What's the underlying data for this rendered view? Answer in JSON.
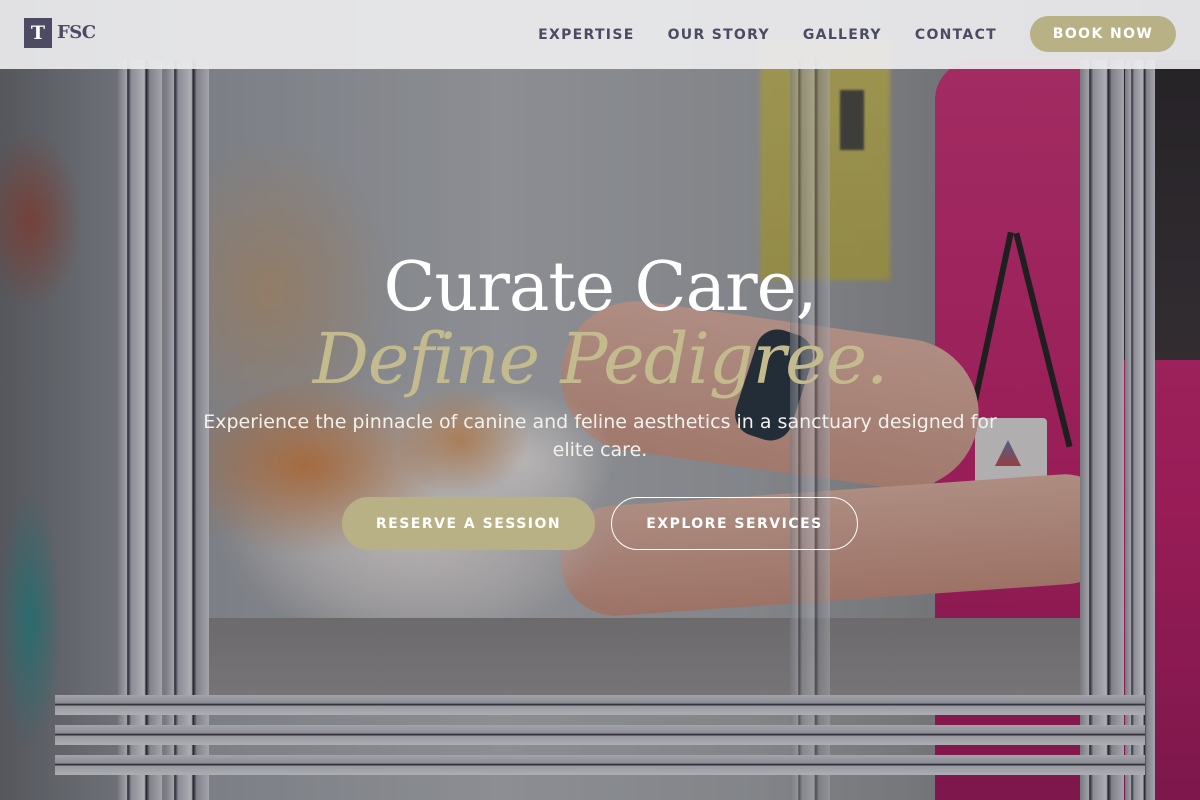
{
  "header": {
    "logo": {
      "mark": "T",
      "text": "FSC"
    },
    "nav": [
      {
        "label": "EXPERTISE"
      },
      {
        "label": "OUR STORY"
      },
      {
        "label": "GALLERY"
      },
      {
        "label": "CONTACT"
      }
    ],
    "cta_label": "BOOK NOW"
  },
  "hero": {
    "title": "Curate Care,",
    "subtitle": "Define Pedigree.",
    "description": "Experience the pinnacle of canine and feline aesthetics in a sanctuary designed for elite care.",
    "primary_button": "RESERVE A SESSION",
    "secondary_button": "EXPLORE SERVICES"
  },
  "colors": {
    "brand_dark": "#4d4a63",
    "accent_gold": "#b8b185",
    "subtitle_gold": "#c3bb8d",
    "header_bg": "#ececee"
  }
}
